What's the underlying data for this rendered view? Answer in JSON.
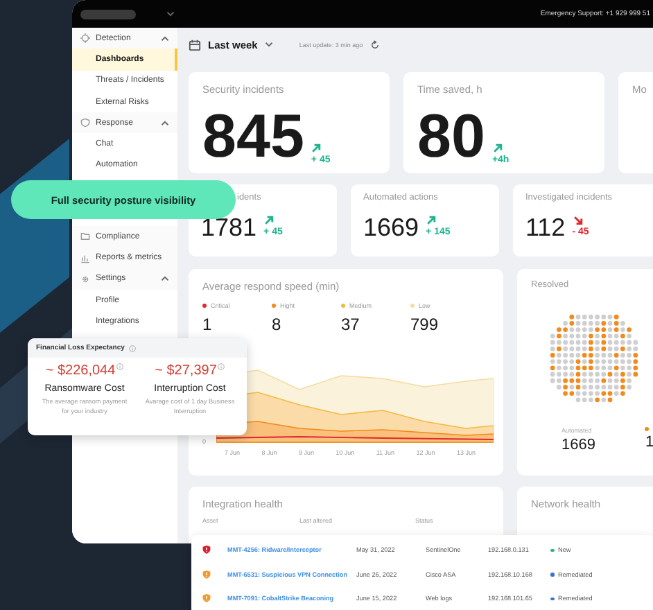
{
  "topbar": {
    "support": "Emergency Support: +1 929 999 51"
  },
  "sidebar": {
    "items": [
      {
        "label": "Detection",
        "expanded": true,
        "children": [
          {
            "label": "Dashboards",
            "selected": true
          },
          {
            "label": "Threats / Incidents",
            "selected": false
          },
          {
            "label": "External Risks",
            "selected": false
          }
        ]
      },
      {
        "label": "Response",
        "expanded": true,
        "children": [
          {
            "label": "Chat",
            "selected": false
          },
          {
            "label": "Automation",
            "selected": false
          }
        ]
      },
      {
        "label": "Compliance"
      },
      {
        "label": "Reports & metrics"
      },
      {
        "label": "Settings",
        "expanded": true,
        "children": [
          {
            "label": "Profile",
            "selected": false
          },
          {
            "label": "Integrations",
            "selected": false
          }
        ]
      }
    ]
  },
  "toolbar": {
    "period": "Last week",
    "last_update": "Last update: 3 min ago"
  },
  "top_stats": [
    {
      "title": "Security incidents",
      "value": "845",
      "kind": "up",
      "delta": "+ 45"
    },
    {
      "title": "Time saved, h",
      "value": "80",
      "kind": "up",
      "delta": "+4h"
    },
    {
      "title": "Mo"
    }
  ],
  "stats": [
    {
      "title": "idents",
      "value": "1781",
      "kind": "up",
      "delta": "+ 45"
    },
    {
      "title": "Automated actions",
      "value": "1669",
      "kind": "up",
      "delta": "+ 145"
    },
    {
      "title": "Investigated incidents",
      "value": "112",
      "kind": "down",
      "delta": "- 45"
    }
  ],
  "speed": {
    "title": "Average respond speed (min)",
    "legend": [
      {
        "label": "Critical",
        "value": "1",
        "color": "#e0262e"
      },
      {
        "label": "Hight",
        "value": "8",
        "color": "#f08a1c"
      },
      {
        "label": "Medium",
        "value": "37",
        "color": "#f5b942"
      },
      {
        "label": "Low",
        "value": "799",
        "color": "#f3dfa0"
      }
    ],
    "y_tick": "0",
    "x_labels": [
      "7 Jun",
      "8 Jun",
      "9 Jun",
      "10 Jun",
      "11 Jun",
      "12 Jun",
      "13 Jun"
    ]
  },
  "resolved": {
    "title": "Resolved",
    "legend": [
      {
        "label": "Automated",
        "value": "1669"
      },
      {
        "value": "1"
      }
    ]
  },
  "integration": {
    "title": "Integration health",
    "columns": [
      "Asset",
      "Last altered",
      "Status"
    ]
  },
  "network": {
    "title": "Network health"
  },
  "promo": "Full security posture visibility",
  "financial": {
    "title": "Financial Loss Expectancy",
    "items": [
      {
        "amount": "~ $226,044",
        "label": "Ransomware Cost",
        "note": "The average ransom payment for your industry"
      },
      {
        "amount": "~ $27,397",
        "label": "Interruption Cost",
        "note": "Avarage cost of 1 day Business Interruption"
      }
    ]
  },
  "incidents": [
    {
      "kind": "critical",
      "name": "MMT-4256: Ridware/Interceptor",
      "date": "May 31, 2022",
      "source": "SentinelOne",
      "ip": "192.168.0.131",
      "status": "New",
      "color": "#2bb673"
    },
    {
      "kind": "warning",
      "name": "MMT-6531: Suspicious VPN Connection",
      "date": "June 26, 2022",
      "source": "Cisco ASA",
      "ip": "192.168.10.168",
      "status": "Remediated",
      "color": "#3b6fd8"
    },
    {
      "kind": "warning",
      "name": "MMT-7091: CobaltStrike Beaconing",
      "date": "June 15, 2022",
      "source": "Web logs",
      "ip": "192.168.101.65",
      "status": "Remediated",
      "color": "#3b6fd8"
    }
  ]
}
